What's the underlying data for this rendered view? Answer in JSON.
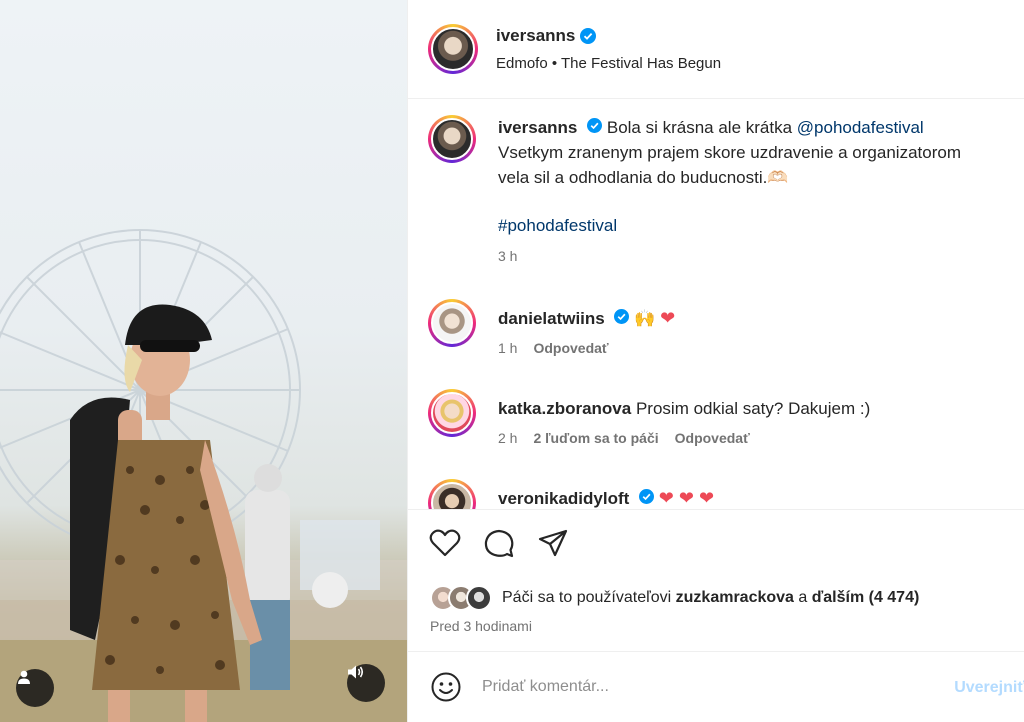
{
  "post": {
    "username": "iversanns",
    "location": "Edmofo • The Festival Has Begun"
  },
  "caption": {
    "username": "iversanns",
    "text_before_mention": "Bola si krásna ale krátka ",
    "mention": "@pohodafestival",
    "line2": "Vsetkym zranenym prajem skore uzdravenie a organizatorom",
    "line3": "vela sil a odhodlania do buducnosti.",
    "line3_emoji": "🫶🏻",
    "hashtag": "#pohodafestival",
    "time": "3 h"
  },
  "comments": [
    {
      "username": "danielatwiins",
      "verified": true,
      "text": "🙌 ",
      "heart": "❤",
      "time": "1 h",
      "reply_label": "Odpovedať"
    },
    {
      "username": "katka.zboranova",
      "verified": false,
      "text": "Prosim odkial saty? Dakujem :)",
      "time": "2 h",
      "likes_label": "2 ľuďom sa to páči",
      "reply_label": "Odpovedať"
    },
    {
      "username": "veronikadidyloft",
      "verified": true,
      "hearts": "❤ ❤ ❤"
    }
  ],
  "likes": {
    "prefix": "Páči sa to používateľovi ",
    "user": "zuzkamrackova",
    "middle": " a ",
    "others": "ďalším (4 474)"
  },
  "time_ago": "Pred 3 hodinami",
  "add_comment": {
    "placeholder": "Pridať komentár...",
    "post_label": "Uverejniť"
  },
  "colors": {
    "verified": "#0095f6",
    "link": "#00376b",
    "heart": "#ed4956",
    "muted": "#737373"
  },
  "icons": [
    "heart-icon",
    "comment-icon",
    "share-icon",
    "emoji-icon",
    "user-tag-icon",
    "audio-icon",
    "verified-icon"
  ]
}
